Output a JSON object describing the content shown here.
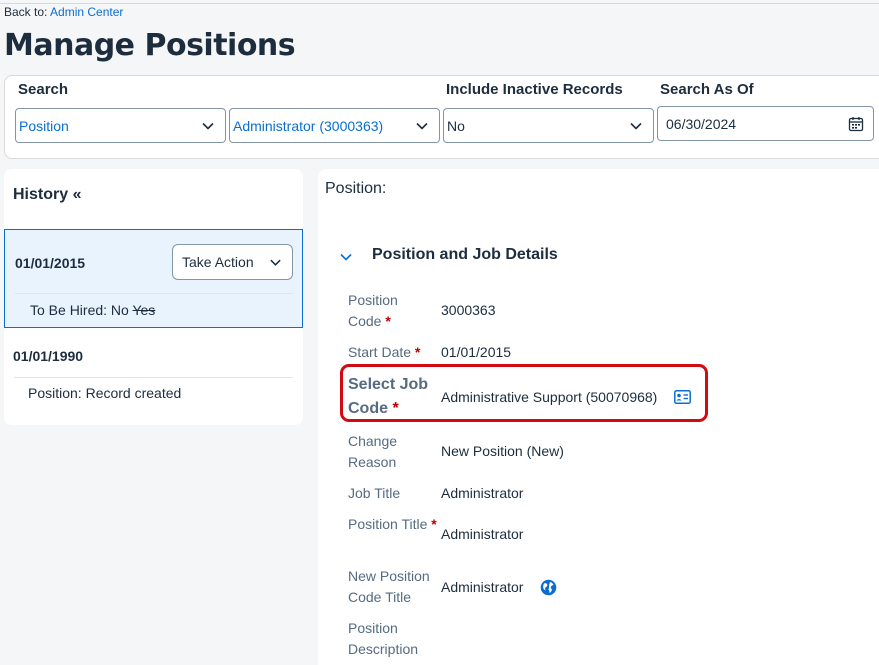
{
  "header": {
    "back_prefix": "Back to:",
    "back_link": "Admin Center",
    "page_title": "Manage Positions"
  },
  "search": {
    "search_label": "Search",
    "type_value": "Position",
    "entity_value": "Administrator (3000363)",
    "inactive_label": "Include Inactive Records",
    "inactive_value": "No",
    "as_of_label": "Search As Of",
    "as_of_value": "06/30/2024"
  },
  "history": {
    "title": "History «",
    "entries": [
      {
        "date": "01/01/2015",
        "action_label": "Take Action",
        "change_label": "To Be Hired: No",
        "change_old": "Yes"
      },
      {
        "date": "01/01/1990",
        "change_label": "Position: Record created"
      }
    ]
  },
  "details": {
    "position_header": "Position:",
    "section_title": "Position and Job Details",
    "fields": {
      "position_code": {
        "label": "Position Code",
        "value": "3000363"
      },
      "start_date": {
        "label": "Start Date",
        "value": "01/01/2015"
      },
      "job_code": {
        "label": "Select Job Code",
        "value": "Administrative Support (50070968)"
      },
      "change_reason": {
        "label": "Change Reason",
        "value": "New Position (New)"
      },
      "job_title": {
        "label": "Job Title",
        "value": "Administrator"
      },
      "position_title": {
        "label": "Position Title",
        "value": "Administrator"
      },
      "new_position_code_title": {
        "label": "New Position Code Title",
        "value": "Administrator"
      },
      "position_description": {
        "label": "Position Description",
        "value": ""
      }
    },
    "required_marker": "*"
  },
  "colors": {
    "accent": "#0a6ed1",
    "highlight": "#d20a11",
    "required": "#bb0000"
  },
  "icons": {
    "dropdown": "chevron-down-icon",
    "calendar": "calendar-icon",
    "collapse": "chevron-down-icon",
    "job_card": "id-card-icon",
    "translate": "globe-icon"
  }
}
